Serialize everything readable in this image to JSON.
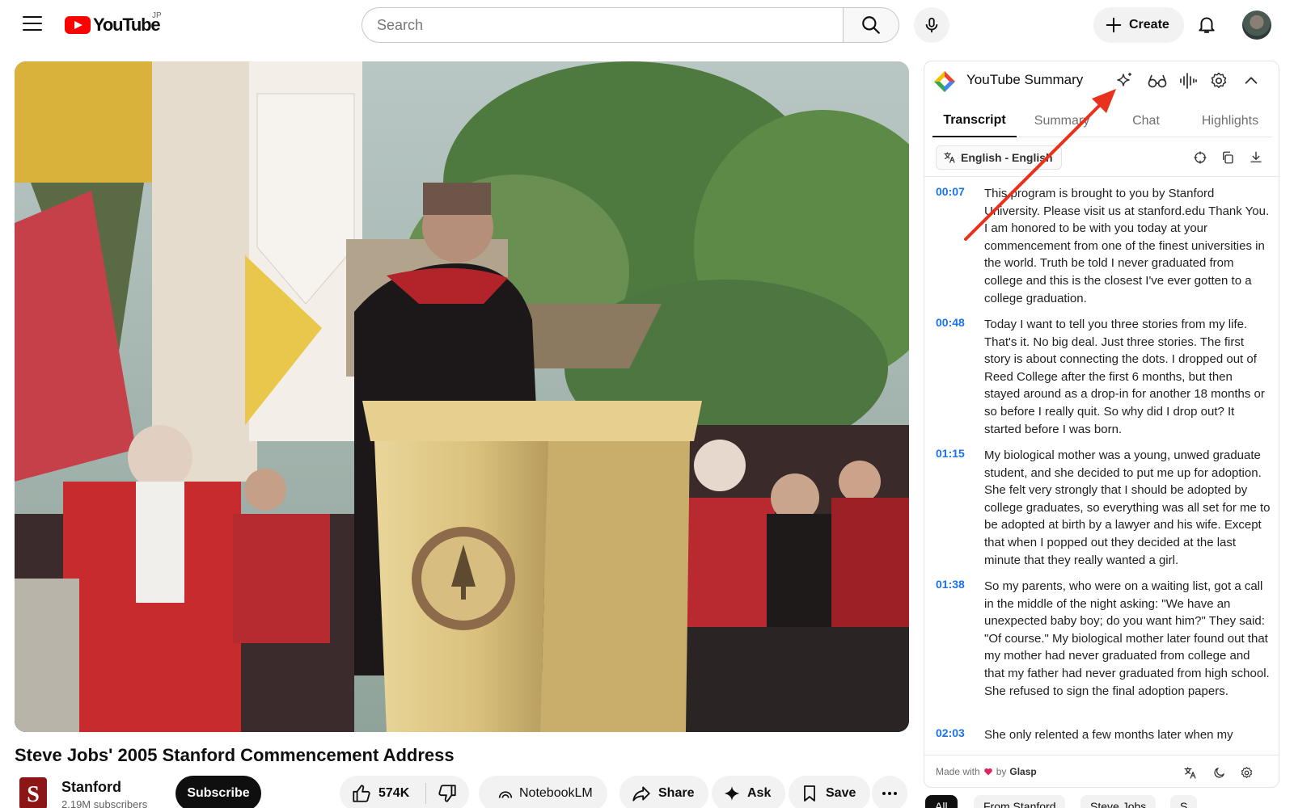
{
  "header": {
    "logo_text": "YouTube",
    "region": "JP",
    "search_placeholder": "Search",
    "create_label": "Create"
  },
  "video": {
    "title": "Steve Jobs' 2005 Stanford Commencement Address"
  },
  "channel": {
    "name": "Stanford",
    "subscribers": "2.19M subscribers",
    "subscribe_label": "Subscribe"
  },
  "actions": {
    "likes": "574K",
    "notebooklm": "NotebookLM",
    "share": "Share",
    "ask": "Ask",
    "save": "Save"
  },
  "summary_panel": {
    "title": "YouTube Summary",
    "tabs": [
      {
        "label": "Transcript",
        "active": true
      },
      {
        "label": "Summary",
        "active": false
      },
      {
        "label": "Chat",
        "active": false
      },
      {
        "label": "Highlights",
        "active": false
      }
    ],
    "language": "English - English",
    "segments": [
      {
        "time": "00:07",
        "text": "This program is brought to you by Stanford University. Please visit us at stanford.edu Thank You. I am honored to be with you today at your commencement from one of the finest universities in the world. Truth be told I never graduated from college and this is the closest I've ever gotten to a college graduation."
      },
      {
        "time": "00:48",
        "text": "Today I want to tell you three stories from my life. That's it. No big deal. Just three stories. The first story is about connecting the dots. I dropped out of Reed College after the first 6 months, but then stayed around as a drop-in for another 18 months or so before I really quit. So why did I drop out? It started before I was born."
      },
      {
        "time": "01:15",
        "text": "My biological mother was a young, unwed graduate student, and she decided to put me up for adoption. She felt very strongly that I should be adopted by college graduates, so everything was all set for me to be adopted at birth by a lawyer and his wife. Except that when I popped out they decided at the last minute that they really wanted a girl."
      },
      {
        "time": "01:38",
        "text": "So my parents, who were on a waiting list, got a call in the middle of the night asking: \"We have an unexpected baby boy; do you want him?\" They said: \"Of course.\" My biological mother later found out that my mother had never graduated from college and that my father had never graduated from high school. She refused to sign the final adoption papers."
      },
      {
        "time": "02:03",
        "text": "She only relented a few months later when my"
      }
    ],
    "footer": {
      "made_with": "Made with",
      "by": "by",
      "brand": "Glasp"
    }
  },
  "chips": [
    {
      "label": "All",
      "active": true
    },
    {
      "label": "From Stanford",
      "active": false
    },
    {
      "label": "Steve Jobs",
      "active": false
    },
    {
      "label": "S",
      "active": false
    }
  ],
  "colors": {
    "brand_red": "#ff0000",
    "timestamp_blue": "#1a73e8",
    "annotation_arrow": "#e8321e"
  }
}
